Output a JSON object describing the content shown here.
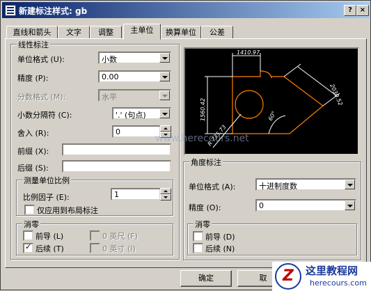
{
  "window": {
    "title": "新建标注样式: gb",
    "help_label": "?",
    "close_label": "×"
  },
  "tabs": [
    {
      "label": "直线和箭头"
    },
    {
      "label": "文字"
    },
    {
      "label": "调整"
    },
    {
      "label": "主单位"
    },
    {
      "label": "换算单位"
    },
    {
      "label": "公差"
    }
  ],
  "linear": {
    "group_label": "线性标注",
    "unit_format": {
      "label": "单位格式 (U):",
      "value": "小数"
    },
    "precision": {
      "label": "精度 (P):",
      "value": "0.00"
    },
    "fraction_format": {
      "label": "分数格式 (M):",
      "value": "水平"
    },
    "decimal_separator": {
      "label": "小数分隔符 (C):",
      "value": "'.' (句点)"
    },
    "round_off": {
      "label": "舍入 (R):",
      "value": "0"
    },
    "prefix": {
      "label": "前缀 (X):",
      "value": ""
    },
    "suffix": {
      "label": "后缀 (S):",
      "value": ""
    }
  },
  "scale": {
    "group_label": "测量单位比例",
    "factor": {
      "label": "比例因子 (E):",
      "value": "1"
    },
    "layout_only": {
      "label": "仅应用到布局标注",
      "checked": false
    }
  },
  "zero_suppression_linear": {
    "group_label": "消零",
    "leading": {
      "label": "前导 (L)",
      "checked": false
    },
    "trailing": {
      "label": "后续 (T)",
      "checked": true
    },
    "feet": {
      "label": "0 英尺 (F)",
      "checked": false
    },
    "inches": {
      "label": "0 英寸 (I)",
      "checked": false
    }
  },
  "preview": {
    "dim_top": "1410.97",
    "dim_left": "1560.42",
    "dim_right": "2030.52",
    "dim_angle": "60°",
    "dim_radius": "R 735.73"
  },
  "angular": {
    "group_label": "角度标注",
    "unit_format": {
      "label": "单位格式 (A):",
      "value": "十进制度数"
    },
    "precision": {
      "label": "精度 (O):",
      "value": "0"
    }
  },
  "zero_suppression_angular": {
    "group_label": "消零",
    "leading": {
      "label": "前导 (D)",
      "checked": false
    },
    "trailing": {
      "label": "后续 (N)",
      "checked": false
    }
  },
  "buttons": {
    "ok": "确定",
    "cancel": "取"
  },
  "watermark": {
    "site_text": "www.herecours.net",
    "logo_letter": "Z",
    "logo_cn": "这里教程网",
    "logo_en": "herecours.com"
  },
  "colors": {
    "preview_bg": "#000000",
    "shape": "#ff8000",
    "dim": "#ffffff",
    "title_start": "#0a246a",
    "title_end": "#a6caf0"
  }
}
